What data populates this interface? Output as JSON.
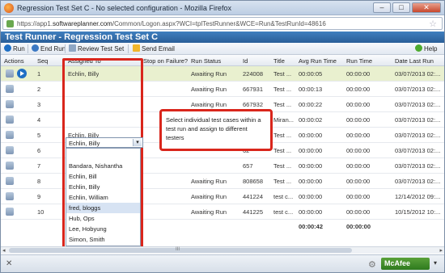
{
  "window": {
    "title": "Regression Test Set C - No selected configuration - Mozilla Firefox",
    "minimize": "–",
    "maximize": "□",
    "close": "✕"
  },
  "address": {
    "url_prefix": "https://app1.",
    "url_domain": "softwareplanner.com",
    "url_rest": "/Common/Logon.aspx?WCI=tplTestRunner&WCE=Run&TestRunId=48616",
    "star": "☆"
  },
  "app": {
    "title": "Test Runner - Regression Test Set C"
  },
  "toolbar": {
    "run": "Run",
    "end_run": "End Run",
    "review": "Review Test Set",
    "send_email": "Send Email",
    "help": "Help"
  },
  "columns": [
    "Actions",
    "Seq",
    "Assigned To",
    "Stop on Failure?",
    "Run Status",
    "Id",
    "Title",
    "Avg Run Time",
    "Run Time",
    "Date Last Run"
  ],
  "rows": [
    {
      "seq": "1",
      "assigned": "Echlin, Billy",
      "status": "Awaiting Run",
      "id": "224008",
      "title": "Test ...",
      "avg": "00:00:05",
      "run": "00:00:00",
      "date": "03/07/2013 02:..."
    },
    {
      "seq": "2",
      "assigned": "",
      "status": "Awaiting Run",
      "id": "667931",
      "title": "Test ...",
      "avg": "00:00:13",
      "run": "00:00:00",
      "date": "03/07/2013 02:..."
    },
    {
      "seq": "3",
      "assigned": "",
      "status": "Awaiting Run",
      "id": "667932",
      "title": "Test ...",
      "avg": "00:00:22",
      "run": "00:00:00",
      "date": "03/07/2013 02:..."
    },
    {
      "seq": "4",
      "assigned": "",
      "status": "",
      "id": "05",
      "title": "Miran...",
      "avg": "00:00:02",
      "run": "00:00:00",
      "date": "03/07/2013 02:..."
    },
    {
      "seq": "5",
      "assigned": "Echlin, Billy",
      "status": "",
      "id": "61",
      "title": "Test ...",
      "avg": "00:00:00",
      "run": "00:00:00",
      "date": "03/07/2013 02:..."
    },
    {
      "seq": "6",
      "assigned": "",
      "status": "",
      "id": "62",
      "title": "Test ...",
      "avg": "00:00:00",
      "run": "00:00:00",
      "date": "03/07/2013 02:..."
    },
    {
      "seq": "7",
      "assigned": "",
      "status": "",
      "id": "657",
      "title": "Test ...",
      "avg": "00:00:00",
      "run": "00:00:00",
      "date": "03/07/2013 02:..."
    },
    {
      "seq": "8",
      "assigned": "",
      "status": "Awaiting Run",
      "id": "808658",
      "title": "Test ...",
      "avg": "00:00:00",
      "run": "00:00:00",
      "date": "03/07/2013 02:..."
    },
    {
      "seq": "9",
      "assigned": "",
      "status": "Awaiting Run",
      "id": "441224",
      "title": "test c...",
      "avg": "00:00:00",
      "run": "00:00:00",
      "date": "12/14/2012 09:..."
    },
    {
      "seq": "10",
      "assigned": "",
      "status": "Awaiting Run",
      "id": "441225",
      "title": "test c...",
      "avg": "00:00:00",
      "run": "00:00:00",
      "date": "10/15/2012 10:..."
    }
  ],
  "totals": {
    "avg": "00:00:42",
    "run": "00:00:00"
  },
  "dropdown": {
    "selected": "Echlin, Billy",
    "arrow": "▾",
    "options": [
      "",
      "Bandara, Nishantha",
      "Echlin, Bill",
      "Echlin, Billy",
      "Echlin, William",
      "fred, bloggs",
      "Hub, Ops",
      "Lee, Hobyung",
      "Simon, Smith"
    ]
  },
  "callout": {
    "text": "Select individual test cases within a test run and assign to different testers"
  },
  "scrollbar": {
    "left": "◂",
    "right": "▸",
    "grip": "III"
  },
  "status": {
    "close": "✕",
    "gear": "⚙",
    "mcafee": "McAfee",
    "down": "▾"
  },
  "colors": {
    "header": "#2a5e98",
    "selected_row": "#e9f0cf",
    "callout_border": "#d9261c"
  }
}
